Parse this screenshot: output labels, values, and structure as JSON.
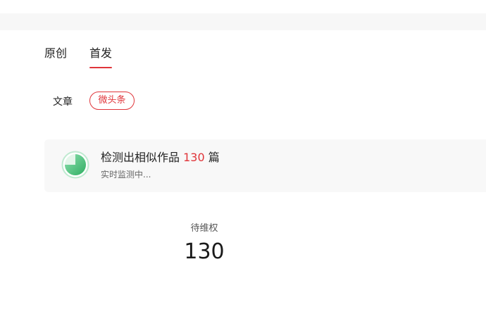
{
  "tabs": [
    {
      "label": "原创",
      "active": false
    },
    {
      "label": "首发",
      "active": true
    }
  ],
  "category": {
    "label": "文章",
    "pill": "微头条"
  },
  "monitor": {
    "title_prefix": "检测出相似作品",
    "count": "130",
    "title_suffix": "篇",
    "status": "实时监测中...",
    "icon": "progress-ring-icon"
  },
  "stat": {
    "label": "待维权",
    "value": "130"
  },
  "colors": {
    "accent": "#e0353a",
    "ring": "#3dbd6f"
  }
}
